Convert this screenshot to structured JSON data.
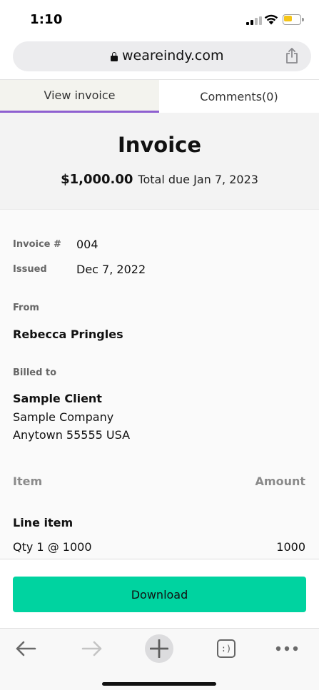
{
  "status_bar": {
    "time": "1:10",
    "battery_color": "#f5c518"
  },
  "browser": {
    "url": "weareindy.com",
    "tabs_label": ":)"
  },
  "tabs": [
    {
      "label": "View invoice",
      "active": true
    },
    {
      "label": "Comments(0)",
      "active": false
    }
  ],
  "invoice": {
    "title": "Invoice",
    "amount": "$1,000.00",
    "due_text": "Total due Jan 7, 2023",
    "number_label": "Invoice #",
    "number": "004",
    "issued_label": "Issued",
    "issued": "Dec 7, 2022",
    "from_label": "From",
    "from_name": "Rebecca Pringles",
    "billed_label": "Billed to",
    "client_name": "Sample Client",
    "client_company": "Sample Company",
    "client_address": "Anytown 55555 USA",
    "item_header": "Item",
    "amount_header": "Amount",
    "line_items": [
      {
        "name": "Line item",
        "detail": "Qty 1 @ 1000",
        "amount": "1000"
      }
    ]
  },
  "actions": {
    "download_label": "Download"
  },
  "colors": {
    "accent_purple": "#8e5fd0",
    "download_green": "#00d3a0"
  }
}
